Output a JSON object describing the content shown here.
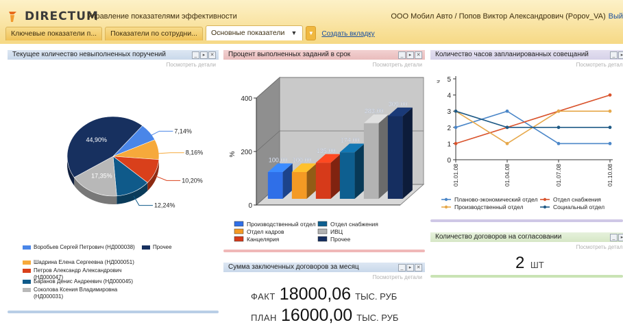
{
  "header": {
    "logo_text": "DIRECTUM",
    "app_title": "Управление показателями эффективности",
    "user": "ООО Мобил Авто / Попов Виктор Александрович (Popov_VA)",
    "exit_label": "Вый"
  },
  "tabs": [
    {
      "label": "Ключевые показатели п..."
    },
    {
      "label": "Показатели по сотрудни..."
    },
    {
      "label": "Основные показатели",
      "active": true
    }
  ],
  "create_tab_label": "Создать вкладку",
  "details_label": "Посмотреть детали",
  "panels": {
    "pie": {
      "title": "Текущее количество невыполненных поручений"
    },
    "bar": {
      "title": "Процент выполненных заданий в срок"
    },
    "line": {
      "title": "Количество часов запланированных совещаний"
    },
    "contracts_sum": {
      "title": "Сумма заключенных договоров за месяц",
      "fact_label": "ФАКТ",
      "fact_value": "18000,06",
      "fact_unit": "ТЫС. РУБ",
      "plan_label": "ПЛАН",
      "plan_value": "16000,00",
      "plan_unit": "ТЫС. РУБ"
    },
    "contracts_count": {
      "title": "Количество договоров на согласовании",
      "value": "2",
      "unit": "ШТ"
    }
  },
  "chart_data": [
    {
      "type": "pie",
      "series": [
        {
          "name": "Воробьев Сергей Петрович (НД000038)",
          "value": 7.14,
          "label": "7,14%",
          "color": "#4a86e8"
        },
        {
          "name": "Шадрина Елена Сергеевна (НД000051)",
          "value": 8.16,
          "label": "8,16%",
          "color": "#f6a93b"
        },
        {
          "name": "Петров Александр Александрович (НД000047)",
          "value": 10.2,
          "label": "10,20%",
          "color": "#d9401b"
        },
        {
          "name": "Баранов Денис Андреевич (НД000045)",
          "value": 12.24,
          "label": "12,24%",
          "color": "#0f5a8a"
        },
        {
          "name": "Соколова Ксения Владимировна (НД000031)",
          "value": 17.35,
          "label": "17,35%",
          "color": "#b8b8b8"
        },
        {
          "name": "Прочее",
          "value": 44.9,
          "label": "44,90%",
          "color": "#17305f"
        }
      ]
    },
    {
      "type": "bar",
      "ylabel": "%",
      "ylim": [
        0,
        400
      ],
      "yticks": [
        "0",
        "200",
        "400"
      ],
      "series": [
        {
          "name": "Производственный отдел",
          "value": 100,
          "label": "100,00",
          "color": "#2f6fe8"
        },
        {
          "name": "Отдел кадров",
          "value": 100,
          "label": "100,00",
          "color": "#f49a24"
        },
        {
          "name": "Канцелярия",
          "value": 135,
          "label": "135,00",
          "color": "#d63a1a"
        },
        {
          "name": "Отдел снабжения",
          "value": 174,
          "label": "174,00",
          "color": "#0e5f90"
        },
        {
          "name": "ИВЦ",
          "value": 283,
          "label": "283,00",
          "color": "#b3b3b3"
        },
        {
          "name": "Прочее",
          "value": 309,
          "label": "309,00",
          "color": "#152e60"
        }
      ]
    },
    {
      "type": "line",
      "ylabel": "ч",
      "ylim": [
        0,
        5
      ],
      "yticks": [
        "0",
        "1",
        "2",
        "3",
        "4",
        "5"
      ],
      "categories": [
        "01.01.08",
        "01.04.08",
        "01.07.08",
        "01.10.08"
      ],
      "series": [
        {
          "name": "Планово-экономический отдел",
          "values": [
            2,
            3,
            1,
            1
          ],
          "color": "#4a86c8"
        },
        {
          "name": "Отдел снабжения",
          "values": [
            1,
            2,
            3,
            4
          ],
          "color": "#d9532c"
        },
        {
          "name": "Производственный отдел",
          "values": [
            3,
            1,
            3,
            3
          ],
          "color": "#e6a84a"
        },
        {
          "name": "Социальный отдел",
          "values": [
            3,
            2,
            2,
            2
          ],
          "color": "#1f5a86"
        }
      ]
    }
  ]
}
